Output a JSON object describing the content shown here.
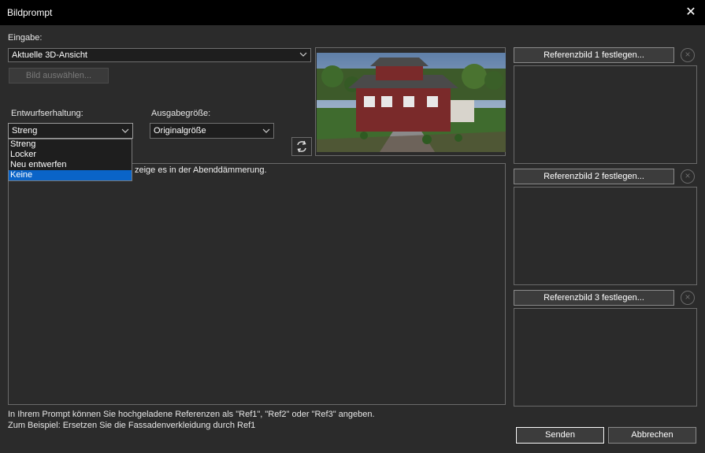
{
  "window": {
    "title": "Bildprompt",
    "close_glyph": "✕"
  },
  "input": {
    "label": "Eingabe:",
    "source_value": "Aktuelle 3D-Ansicht",
    "choose_image_label": "Bild auswählen..."
  },
  "design_retention": {
    "label": "Entwurfserhaltung:",
    "value": "Streng",
    "options": [
      "Streng",
      "Locker",
      "Neu entwerfen",
      "Keine"
    ]
  },
  "output_size": {
    "label": "Ausgabegröße:",
    "value": "Originalgröße"
  },
  "prompt": {
    "visible_text": "zeige es in der Abenddämmerung."
  },
  "references": [
    {
      "button_label": "Referenzbild 1 festlegen..."
    },
    {
      "button_label": "Referenzbild 2 festlegen..."
    },
    {
      "button_label": "Referenzbild 3 festlegen..."
    }
  ],
  "hints": {
    "line1": "In Ihrem Prompt können Sie hochgeladene Referenzen als \"Ref1\", \"Ref2\" oder \"Ref3\" angeben.",
    "line2": "Zum Beispiel: Ersetzen Sie die Fassadenverkleidung durch Ref1"
  },
  "actions": {
    "send_label": "Senden",
    "cancel_label": "Abbrechen"
  },
  "icons": {
    "close": "close-icon",
    "chevron": "chevron-down-icon",
    "refresh": "refresh-icon",
    "remove": "remove-circle-icon"
  }
}
